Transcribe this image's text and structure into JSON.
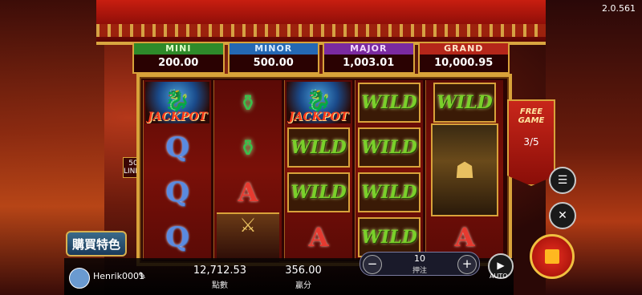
{
  "version": "2.0.561",
  "jackpots": [
    {
      "label": "MINI",
      "value": "200.00"
    },
    {
      "label": "MINOR",
      "value": "500.00"
    },
    {
      "label": "MAJOR",
      "value": "1,003.01"
    },
    {
      "label": "GRAND",
      "value": "10,000.95"
    }
  ],
  "lines_label": "50\nLINES",
  "reels": {
    "r1": {
      "jackpot_text": "JACKPOT",
      "q1": "Q",
      "q2": "Q",
      "q3": "Q"
    },
    "r2": {
      "a": "A"
    },
    "r3": {
      "jackpot_text": "JACKPOT",
      "wild1": "WILD",
      "wild2": "WILD",
      "a": "A"
    },
    "r4": {
      "wild1": "WILD",
      "wild2": "WILD",
      "wild3": "WILD",
      "wild4": "WILD"
    },
    "r5": {
      "wild1": "WILD",
      "a": "A"
    }
  },
  "free_game": {
    "title": "FREE\nGAME",
    "count": "3/5"
  },
  "buy_feature": "購買特色",
  "player": {
    "username": "Henrik0001"
  },
  "balance": {
    "value": "12,712.53",
    "label": "點數"
  },
  "win": {
    "value": "356.00",
    "label": "贏分"
  },
  "bet": {
    "value": "10",
    "label": "押注",
    "minus": "−",
    "plus": "+"
  },
  "auto_label": "AUTO",
  "icons": {
    "menu": "menu-icon",
    "turbo": "turbo-icon",
    "stop": "stop-icon",
    "edit": "edit-icon",
    "play": "play-icon"
  }
}
